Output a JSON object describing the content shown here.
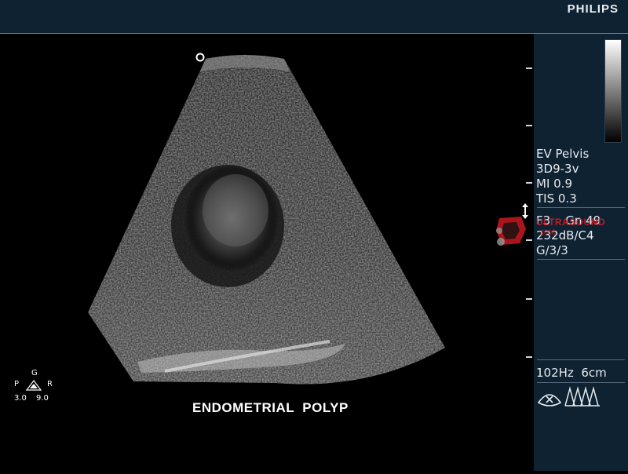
{
  "brand": "PHILIPS",
  "preset": {
    "exam": "EV Pelvis",
    "transducer": "3D9-3v",
    "mi": "MI 0.9",
    "tis": "TIS 0.3"
  },
  "settings": {
    "line1": "F3    Gn 49",
    "line2": "232dB/C4",
    "line3": "G/3/3"
  },
  "status": {
    "freq_depth": "102Hz  6cm"
  },
  "caption": "ENDOMETRIAL  POLYP",
  "orientation": {
    "top": "G",
    "left": "P",
    "right": "R",
    "bottom_left": "3.0",
    "bottom_right": "9.0"
  },
  "watermark": {
    "text": "ULTRASOUND",
    "sub": "2008"
  },
  "colors": {
    "panel": "#0f2232",
    "text": "#e6ebef",
    "watermark": "#d91c24"
  }
}
